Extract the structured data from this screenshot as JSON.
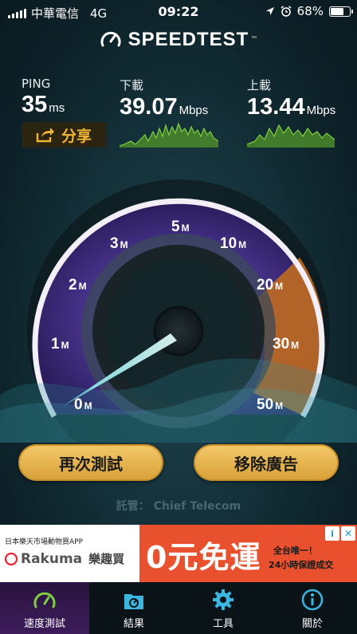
{
  "status_bar": {
    "carrier": "中華電信",
    "network": "4G",
    "time": "09:22",
    "battery": "68%"
  },
  "app": {
    "title": "SPEEDTEST",
    "trademark": "™"
  },
  "ping": {
    "label": "PING",
    "value": "35",
    "unit": "ms"
  },
  "download": {
    "label": "下載",
    "value": "39.07",
    "unit": "Mbps"
  },
  "upload": {
    "label": "上載",
    "value": "13.44",
    "unit": "Mbps"
  },
  "share_label": "分享",
  "gauge": {
    "ticks": [
      {
        "num": "0",
        "u": "M"
      },
      {
        "num": "1",
        "u": "M"
      },
      {
        "num": "2",
        "u": "M"
      },
      {
        "num": "3",
        "u": "M"
      },
      {
        "num": "5",
        "u": "M"
      },
      {
        "num": "10",
        "u": "M"
      },
      {
        "num": "20",
        "u": "M"
      },
      {
        "num": "30",
        "u": "M"
      },
      {
        "num": "50",
        "u": "M"
      }
    ]
  },
  "buttons": {
    "retest": "再次測試",
    "remove_ads": "移除廣告"
  },
  "host": {
    "label": "託管：",
    "name": "Chief Telecom"
  },
  "ad": {
    "line1": "日本樂天市場動物買APP",
    "brand": "Rakuma",
    "brand_cn": "樂趣買",
    "headline": "0元免運",
    "sub1": "全台唯一！",
    "sub2": "24小時保證成交"
  },
  "tabs": [
    {
      "label": "速度測試",
      "icon": "speedometer-icon"
    },
    {
      "label": "結果",
      "icon": "results-folder-icon"
    },
    {
      "label": "工具",
      "icon": "gear-icon"
    },
    {
      "label": "關於",
      "icon": "info-icon"
    }
  ],
  "colors": {
    "accent": "#f2b534",
    "active_tab": "#3c1c5a",
    "graph_green": "#6fc23a"
  }
}
